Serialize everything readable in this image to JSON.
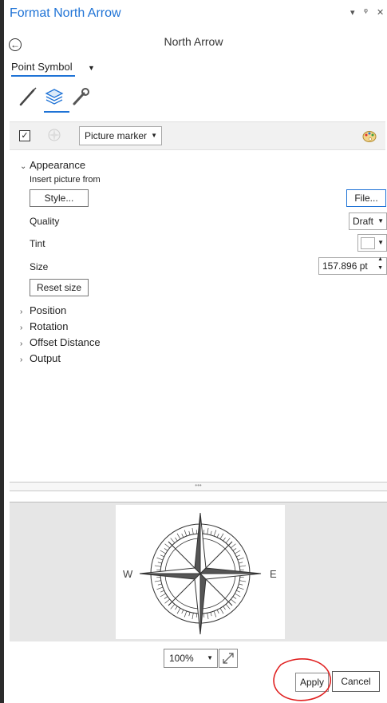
{
  "window": {
    "title": "Format North Arrow",
    "controls": [
      "▾",
      "ᵠ",
      "✕"
    ]
  },
  "header": {
    "title": "North Arrow"
  },
  "mode": {
    "label": "Point Symbol"
  },
  "tabs": [
    {
      "icon": "brush-icon"
    },
    {
      "icon": "layers-icon",
      "selected": true
    },
    {
      "icon": "wrench-icon"
    }
  ],
  "layer": {
    "checked": "✓",
    "marker_type": "Picture marker"
  },
  "appearance": {
    "title": "Appearance",
    "insert_from": "Insert picture from",
    "style_button": "Style...",
    "file_button": "File...",
    "quality_label": "Quality",
    "quality_value": "Draft",
    "tint_label": "Tint",
    "size_label": "Size",
    "size_value": "157.896 pt",
    "reset_size_button": "Reset size"
  },
  "sections": [
    "Position",
    "Rotation",
    "Offset Distance",
    "Output"
  ],
  "preview": {
    "west": "W",
    "east": "E",
    "zoom": "100%"
  },
  "footer": {
    "apply": "Apply",
    "cancel": "Cancel"
  },
  "colors": {
    "accent": "#1f73d6",
    "highlight_circle": "#e02020"
  }
}
